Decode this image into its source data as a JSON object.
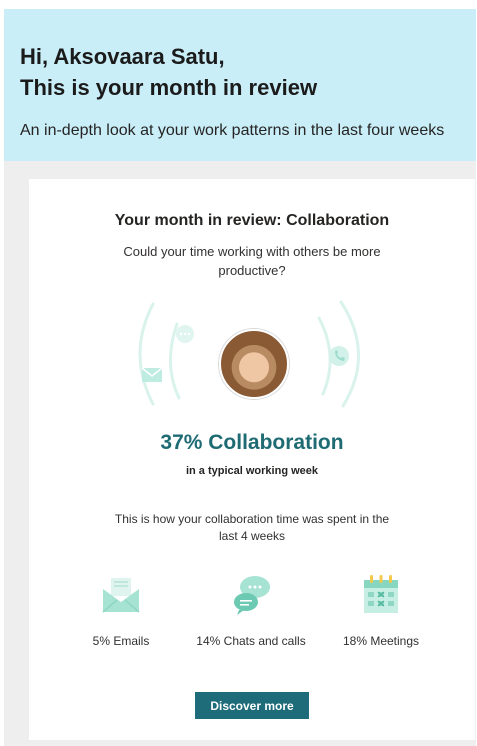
{
  "header": {
    "greeting_line1": "Hi, Aksovaara Satu,",
    "greeting_line2": "This is your month in review",
    "subtitle": "An in-depth look at your work patterns in the last four weeks"
  },
  "card": {
    "title": "Your month in review: Collaboration",
    "question": "Could your time working with others be more productive?",
    "collaboration_percent": "37% Collaboration",
    "collaboration_sub": "in a typical working week",
    "spent_text": "This is how your collaboration time was spent in the last 4 weeks",
    "stats": [
      {
        "label": "5% Emails",
        "icon": "envelope-icon"
      },
      {
        "label": "14% Chats and calls",
        "icon": "chat-bubble-icon"
      },
      {
        "label": "18% Meetings",
        "icon": "calendar-icon"
      }
    ],
    "cta_label": "Discover more"
  },
  "colors": {
    "banner": "#c9eef8",
    "accent": "#1e6b73",
    "button": "#1e6b7a",
    "icon_mint": "#a6e3d3"
  }
}
